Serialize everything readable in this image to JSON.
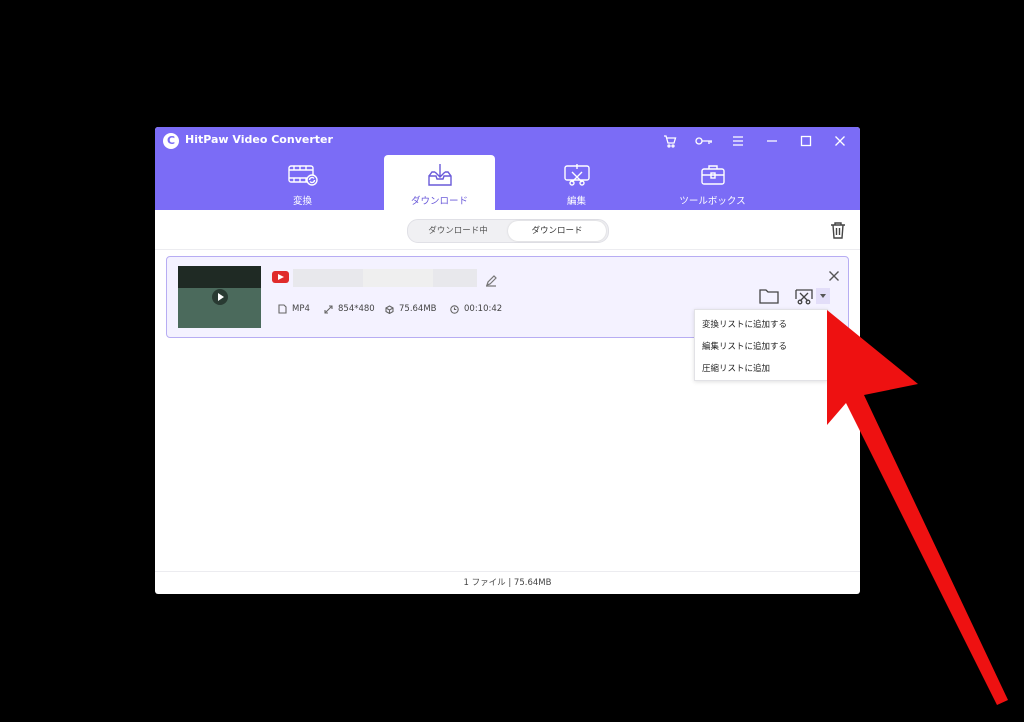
{
  "app": {
    "title": "HitPaw Video Converter",
    "logo_letter": "C"
  },
  "titlebar_icons": [
    "cart-icon",
    "key-icon",
    "menu-icon",
    "minimize-icon",
    "maximize-icon",
    "close-icon"
  ],
  "nav": {
    "tabs": [
      {
        "label": "変換",
        "icon": "film-convert-icon"
      },
      {
        "label": "ダウンロード",
        "icon": "download-tray-icon",
        "active": true
      },
      {
        "label": "編集",
        "icon": "edit-scissors-icon"
      },
      {
        "label": "ツールボックス",
        "icon": "toolbox-icon"
      }
    ]
  },
  "subtabs": [
    {
      "label": "ダウンロード中"
    },
    {
      "label": "ダウンロード",
      "active": true
    }
  ],
  "item": {
    "source_icon": "youtube-icon",
    "format": "MP4",
    "resolution": "854*480",
    "size": "75.64MB",
    "duration": "00:10:42"
  },
  "dropdown": {
    "items": [
      "変換リストに追加する",
      "編集リストに追加する",
      "圧縮リストに追加"
    ]
  },
  "status": {
    "text": "1 ファイル | 75.64MB"
  },
  "colors": {
    "accent": "#7b6cf6",
    "annotation_arrow": "#ee1111"
  }
}
